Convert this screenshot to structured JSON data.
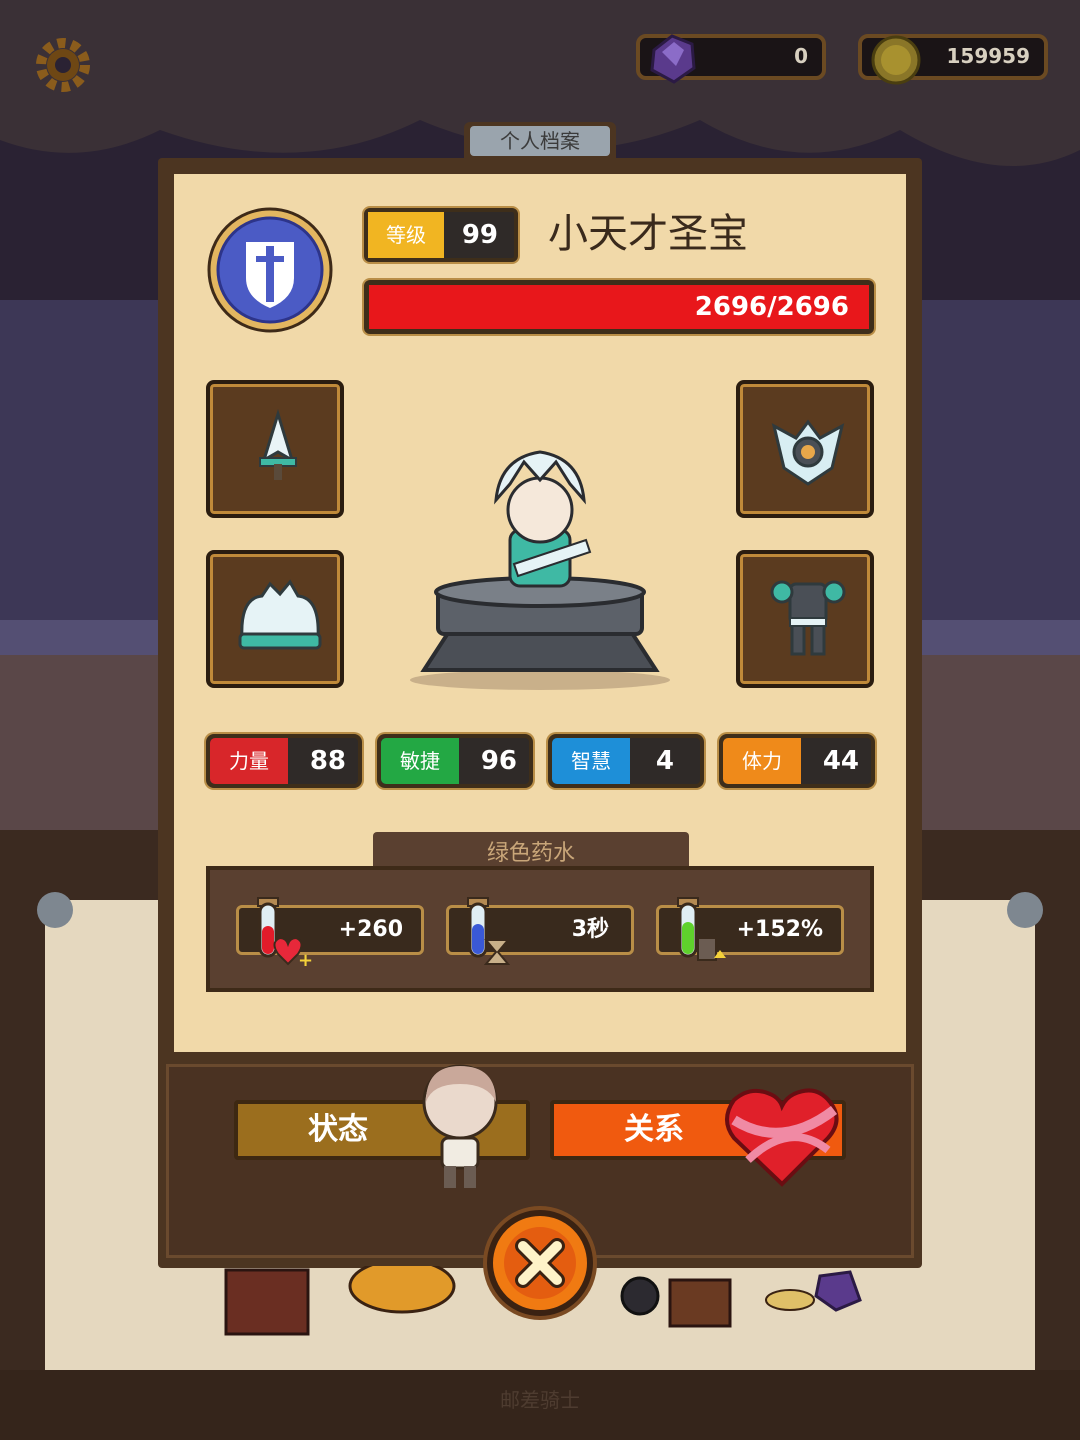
{
  "resources": {
    "gems": "0",
    "coins": "159959"
  },
  "profile": {
    "tab_title": "个人档案",
    "level_label": "等级",
    "level": "99",
    "name": "小天才圣宝",
    "hp_text": "2696/2696",
    "hp_fraction": 1.0
  },
  "equipment": {
    "weapon": "weapon-icon",
    "shield": "shield-icon",
    "helmet": "helmet-icon",
    "armor": "armor-icon"
  },
  "stats": [
    {
      "label": "力量",
      "value": "88",
      "color": "#d8262a"
    },
    {
      "label": "敏捷",
      "value": "96",
      "color": "#23a844"
    },
    {
      "label": "智慧",
      "value": "4",
      "color": "#1e8fd8"
    },
    {
      "label": "体力",
      "value": "44",
      "color": "#ef8a1a"
    }
  ],
  "potion": {
    "title": "绿色药水",
    "effects": [
      {
        "value": "+260",
        "icon": "red-potion-heart-icon"
      },
      {
        "value": "3秒",
        "icon": "blue-potion-hourglass-icon"
      },
      {
        "value": "+152%",
        "icon": "green-potion-boost-icon"
      }
    ]
  },
  "buttons": {
    "status": "状态",
    "relationship": "关系"
  },
  "footer": {
    "caption": "邮差骑士"
  },
  "colors": {
    "hp_bar": "#e8171b",
    "status_button": "#9b6e1e",
    "relationship_button": "#f05a0f",
    "close_button": "#f07a12"
  }
}
